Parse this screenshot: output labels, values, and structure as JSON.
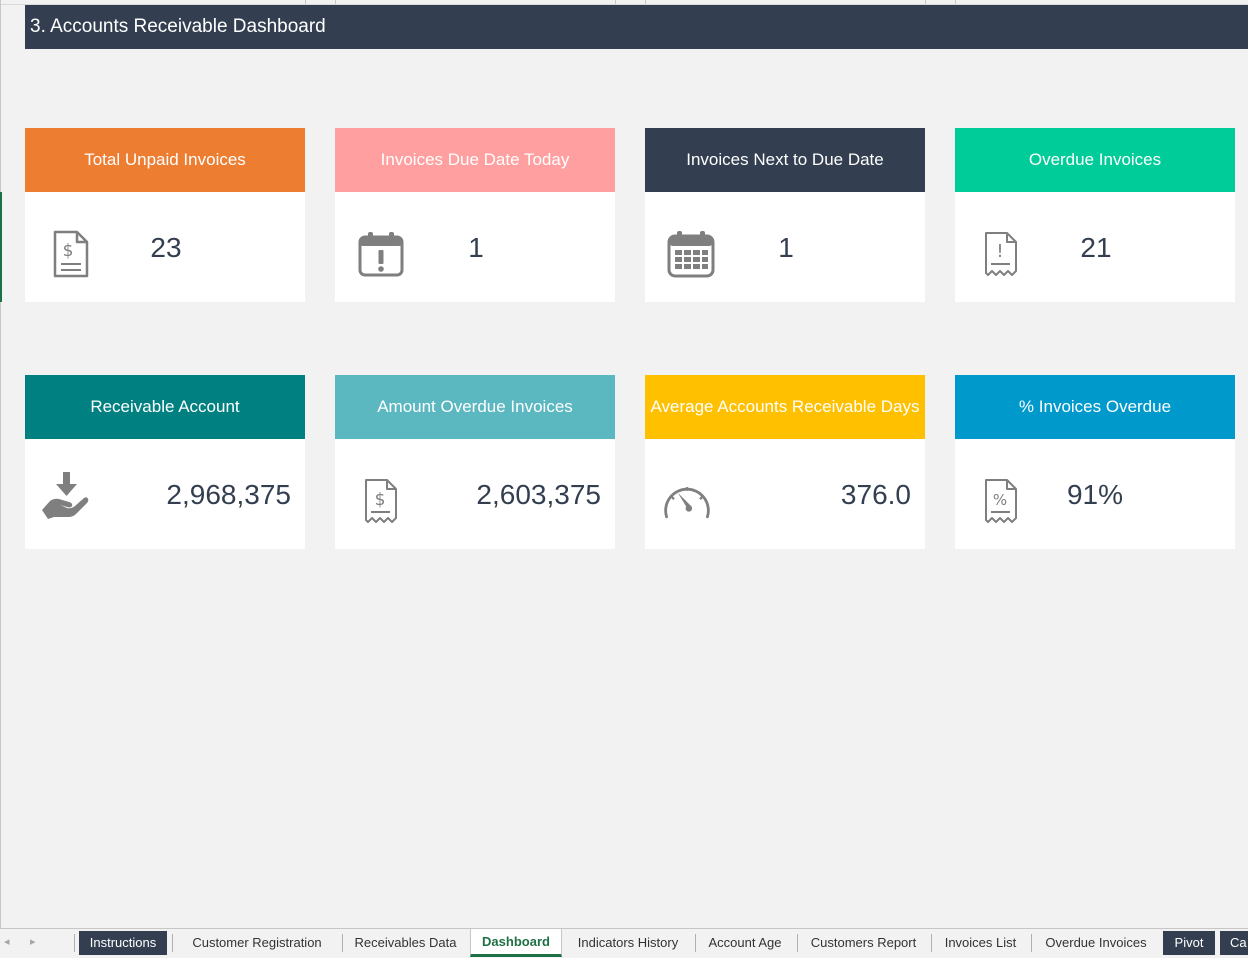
{
  "dashboard": {
    "title": "3. Accounts Receivable Dashboard"
  },
  "colors": {
    "title_bar": "#333f50",
    "orange": "#ed7d31",
    "pink": "#ff9f9f",
    "navy": "#333f50",
    "green": "#00cc99",
    "teal": "#008080",
    "light_teal": "#5bb7c0",
    "yellow": "#ffc000",
    "blue": "#0099cc",
    "icon_gray": "#7f7f7f",
    "active_tab": "#1e7145"
  },
  "cards": [
    {
      "label": "Total Unpaid Invoices",
      "value": "23",
      "icon": "invoice-dollar-icon",
      "color": "orange"
    },
    {
      "label": "Invoices Due Date Today",
      "value": "1",
      "icon": "calendar-exclamation-icon",
      "color": "pink"
    },
    {
      "label": "Invoices Next to Due Date",
      "value": "1",
      "icon": "calendar-grid-icon",
      "color": "navy"
    },
    {
      "label": "Overdue Invoices",
      "value": "21",
      "icon": "receipt-exclamation-icon",
      "color": "green"
    },
    {
      "label": "Receivable Account",
      "value": "2,968,375",
      "icon": "hand-download-icon",
      "color": "teal"
    },
    {
      "label": "Amount Overdue Invoices",
      "value": "2,603,375",
      "icon": "receipt-dollar-icon",
      "color": "light_teal"
    },
    {
      "label": "Average Accounts Receivable Days",
      "value": "376.0",
      "icon": "speedometer-icon",
      "color": "yellow"
    },
    {
      "label": "% Invoices Overdue",
      "value": "91%",
      "icon": "receipt-percent-icon",
      "color": "blue"
    }
  ],
  "sheet_tabs": [
    {
      "label": "Instructions",
      "style": "dark"
    },
    {
      "label": "Customer Registration",
      "style": "normal"
    },
    {
      "label": "Receivables Data",
      "style": "normal"
    },
    {
      "label": "Dashboard",
      "style": "active"
    },
    {
      "label": "Indicators History",
      "style": "normal"
    },
    {
      "label": "Account Age",
      "style": "normal"
    },
    {
      "label": "Customers Report",
      "style": "normal"
    },
    {
      "label": "Invoices List",
      "style": "normal"
    },
    {
      "label": "Overdue Invoices",
      "style": "normal"
    },
    {
      "label": "Pivot",
      "style": "dark"
    },
    {
      "label": "Ca",
      "style": "dark"
    }
  ],
  "nav": {
    "prev": "◂",
    "next": "▸"
  }
}
